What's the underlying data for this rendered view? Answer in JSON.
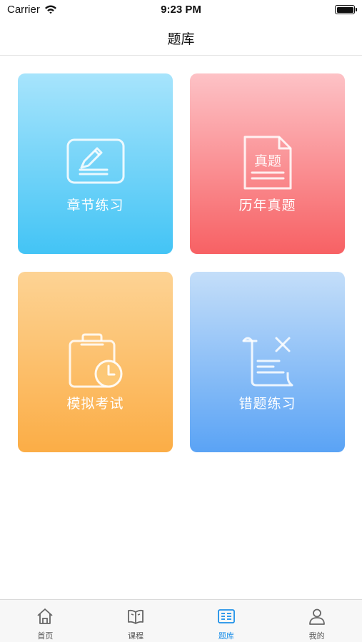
{
  "status_bar": {
    "carrier": "Carrier",
    "time": "9:23 PM",
    "icons": [
      "wifi-icon",
      "battery-icon"
    ]
  },
  "nav": {
    "title": "题库"
  },
  "cards": [
    {
      "label": "章节练习",
      "icon": "edit-board-icon",
      "color_top": "#a7e4fc",
      "color_bottom": "#43c4f5"
    },
    {
      "label": "历年真题",
      "icon": "document-icon",
      "icon_text": "真题",
      "color_top": "#fdc2c6",
      "color_bottom": "#f76164"
    },
    {
      "label": "模拟考试",
      "icon": "clipboard-clock-icon",
      "color_top": "#fdd394",
      "color_bottom": "#fbad46"
    },
    {
      "label": "错题练习",
      "icon": "scroll-x-icon",
      "color_top": "#c4def9",
      "color_bottom": "#5aa3f5"
    }
  ],
  "tabs": [
    {
      "label": "首页",
      "icon": "home-icon",
      "active": false
    },
    {
      "label": "课程",
      "icon": "book-icon",
      "active": false
    },
    {
      "label": "题库",
      "icon": "question-bank-icon",
      "active": true
    },
    {
      "label": "我的",
      "icon": "user-icon",
      "active": false
    }
  ],
  "colors": {
    "active_tab": "#1c8fe8",
    "inactive_tab": "#555555",
    "tab_bar_bg": "#f7f7f7"
  }
}
